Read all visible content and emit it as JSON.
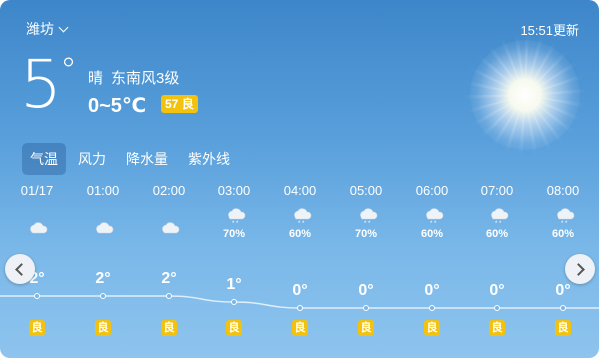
{
  "location": {
    "city": "潍坊"
  },
  "update_time": "15:51更新",
  "current": {
    "temp": "5",
    "degree": "°",
    "condition": "晴",
    "wind": "东南风3级",
    "range": "0~5℃",
    "aqi_value": "57",
    "aqi_label": "良",
    "aqi_color": "#f2c20f"
  },
  "tabs": [
    {
      "label": "气温",
      "active": true
    },
    {
      "label": "风力",
      "active": false
    },
    {
      "label": "降水量",
      "active": false
    },
    {
      "label": "紫外线",
      "active": false
    }
  ],
  "hourly": [
    {
      "time": "01/17",
      "icon": "cloudy-icon",
      "precip": "",
      "temp": "2°",
      "temp_value": 2,
      "aqi": "良"
    },
    {
      "time": "01:00",
      "icon": "cloudy-icon",
      "precip": "",
      "temp": "2°",
      "temp_value": 2,
      "aqi": "良"
    },
    {
      "time": "02:00",
      "icon": "cloudy-icon",
      "precip": "",
      "temp": "2°",
      "temp_value": 2,
      "aqi": "良"
    },
    {
      "time": "03:00",
      "icon": "snow-cloud-icon",
      "precip": "70%",
      "temp": "1°",
      "temp_value": 1,
      "aqi": "良"
    },
    {
      "time": "04:00",
      "icon": "snow-cloud-icon",
      "precip": "60%",
      "temp": "0°",
      "temp_value": 0,
      "aqi": "良"
    },
    {
      "time": "05:00",
      "icon": "snow-cloud-icon",
      "precip": "70%",
      "temp": "0°",
      "temp_value": 0,
      "aqi": "良"
    },
    {
      "time": "06:00",
      "icon": "snow-cloud-icon",
      "precip": "60%",
      "temp": "0°",
      "temp_value": 0,
      "aqi": "良"
    },
    {
      "time": "07:00",
      "icon": "snow-cloud-icon",
      "precip": "60%",
      "temp": "0°",
      "temp_value": 0,
      "aqi": "良"
    },
    {
      "time": "08:00",
      "icon": "snow-cloud-icon",
      "precip": "60%",
      "temp": "0°",
      "temp_value": 0,
      "aqi": "良"
    }
  ],
  "colors": {
    "accent_aqi": "#f2c20f",
    "sky_top": "#3d86c9",
    "sky_bottom": "#8ec4ee"
  }
}
